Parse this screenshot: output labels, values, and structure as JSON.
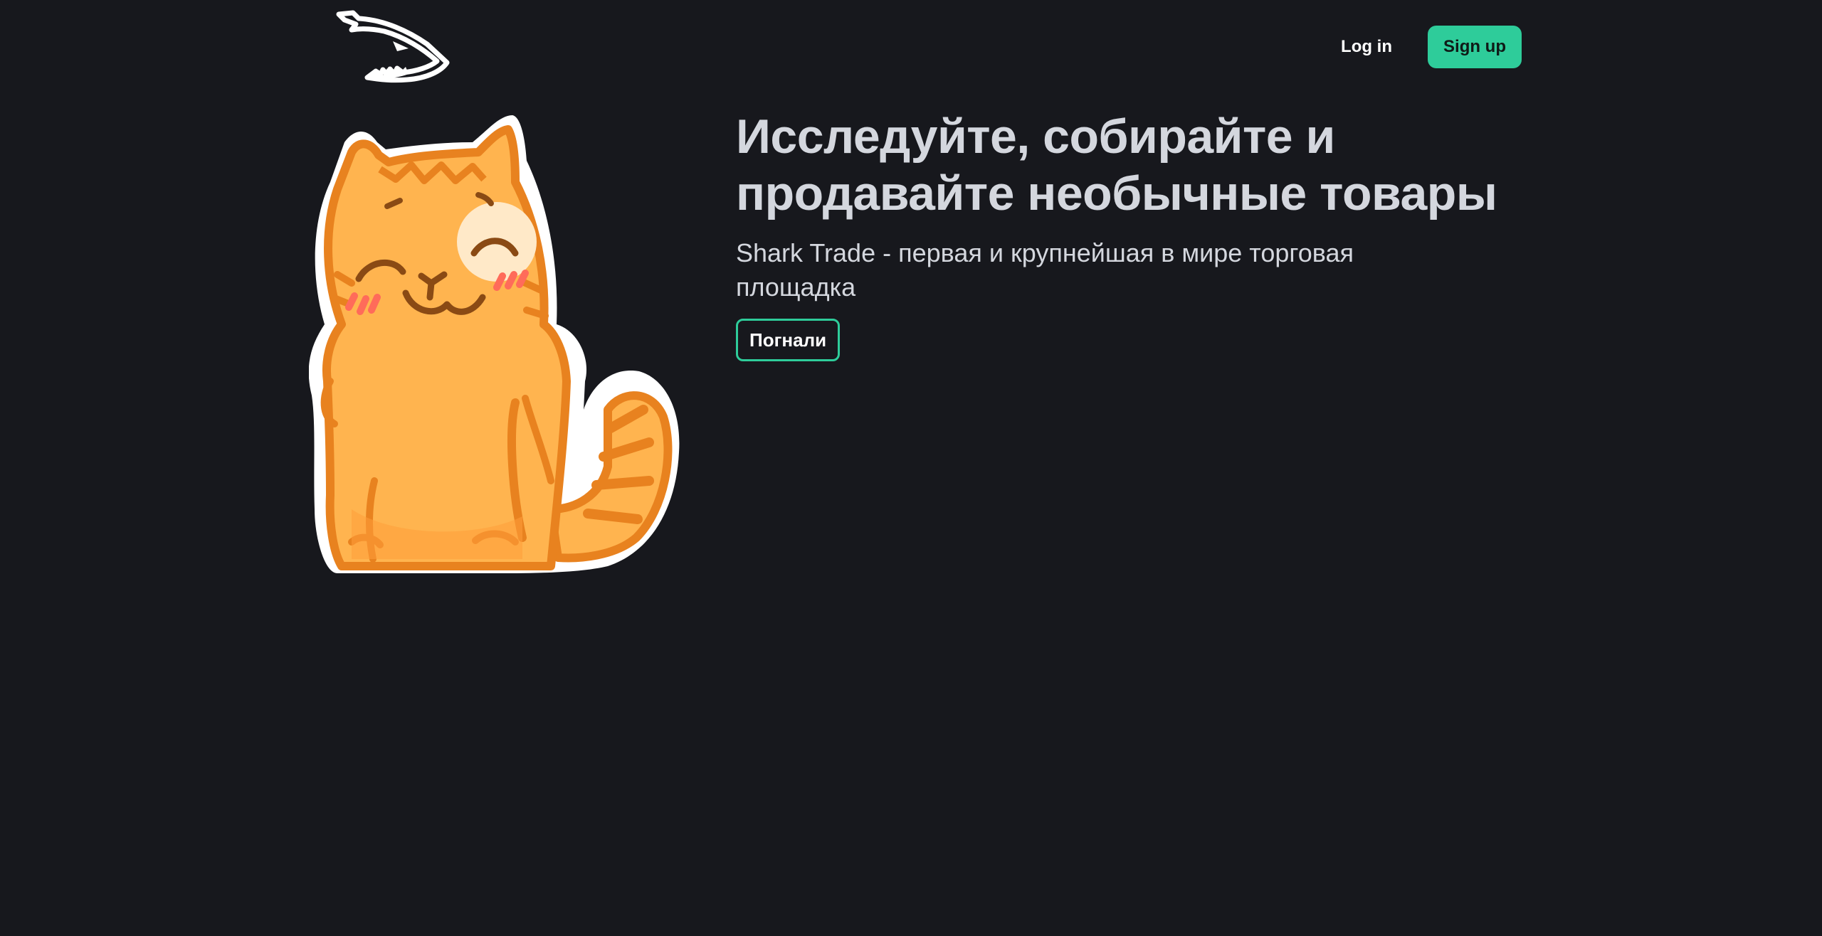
{
  "header": {
    "logo": {
      "icon": "shark-logo-icon",
      "color": "#ffffff"
    },
    "login_label": "Log in",
    "signup_label": "Sign up"
  },
  "hero": {
    "image": {
      "icon": "smiling-orange-cat-sticker",
      "colors": {
        "fur": "#ffb44f",
        "stroke": "#e8821f",
        "outline": "#ffffff"
      }
    },
    "title": "Исследуйте, собирайте и продавайте необычные товары",
    "subtitle": "Shark Trade - первая и крупнейшая в мире торговая площадка",
    "cta_label": "Погнали"
  },
  "theme": {
    "background": "#17181d",
    "accent": "#2ecc9a",
    "text": "#d4d7de"
  }
}
